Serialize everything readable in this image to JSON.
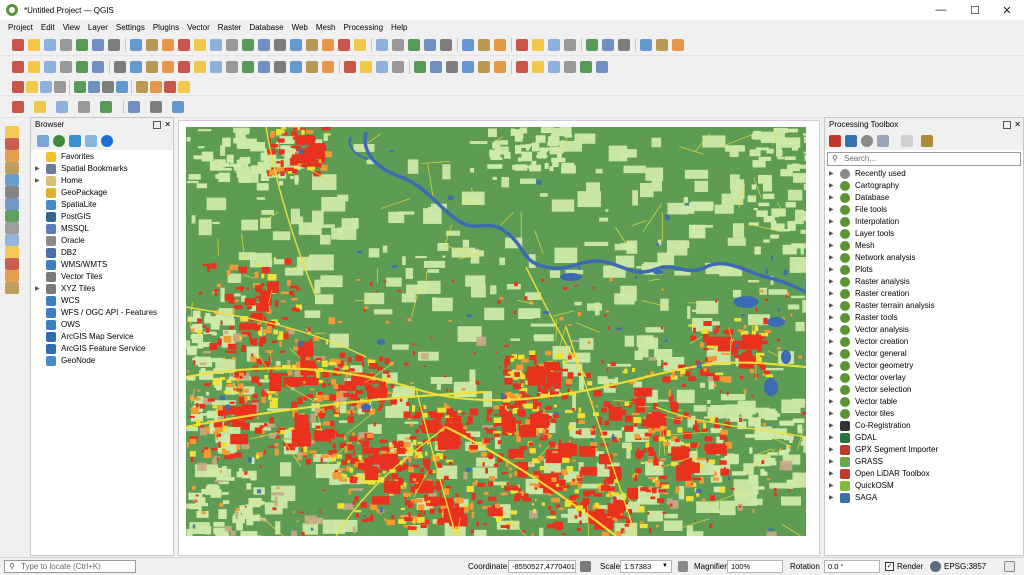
{
  "window": {
    "title": "*Untitled Project — QGIS",
    "minimize": "—",
    "maximize": "☐",
    "close": "✕"
  },
  "menu": [
    "Project",
    "Edit",
    "View",
    "Layer",
    "Settings",
    "Plugins",
    "Vector",
    "Raster",
    "Database",
    "Web",
    "Mesh",
    "Processing",
    "Help"
  ],
  "browser": {
    "title": "Browser",
    "items": [
      {
        "label": "Favorites",
        "icon": "star-icon",
        "color": "#f2c12e",
        "arrow": false
      },
      {
        "label": "Spatial Bookmarks",
        "icon": "bookmark-icon",
        "color": "#6b7d9a",
        "arrow": true
      },
      {
        "label": "Home",
        "icon": "home-folder-icon",
        "color": "#d7c07a",
        "arrow": true
      },
      {
        "label": "GeoPackage",
        "icon": "geopackage-icon",
        "color": "#e0b030",
        "arrow": false
      },
      {
        "label": "SpatiaLite",
        "icon": "spatialite-icon",
        "color": "#4a89c8",
        "arrow": false
      },
      {
        "label": "PostGIS",
        "icon": "postgis-icon",
        "color": "#336791",
        "arrow": false
      },
      {
        "label": "MSSQL",
        "icon": "mssql-icon",
        "color": "#5a7fb8",
        "arrow": false
      },
      {
        "label": "Oracle",
        "icon": "oracle-icon",
        "color": "#8a8a8a",
        "arrow": false
      },
      {
        "label": "DB2",
        "icon": "db2-icon",
        "color": "#4c6fa8",
        "arrow": false
      },
      {
        "label": "WMS/WMTS",
        "icon": "wms-icon",
        "color": "#3d7fc0",
        "arrow": false
      },
      {
        "label": "Vector Tiles",
        "icon": "vector-tiles-icon",
        "color": "#7a7a7a",
        "arrow": false
      },
      {
        "label": "XYZ Tiles",
        "icon": "xyz-tiles-icon",
        "color": "#7a7a7a",
        "arrow": true
      },
      {
        "label": "WCS",
        "icon": "wcs-icon",
        "color": "#3d7fc0",
        "arrow": false
      },
      {
        "label": "WFS / OGC API - Features",
        "icon": "wfs-icon",
        "color": "#3d7fc0",
        "arrow": false
      },
      {
        "label": "OWS",
        "icon": "ows-icon",
        "color": "#3d7fc0",
        "arrow": false
      },
      {
        "label": "ArcGIS Map Service",
        "icon": "arcgis-map-icon",
        "color": "#2f6ea8",
        "arrow": false
      },
      {
        "label": "ArcGIS Feature Service",
        "icon": "arcgis-feature-icon",
        "color": "#2f6ea8",
        "arrow": false
      },
      {
        "label": "GeoNode",
        "icon": "geonode-icon",
        "color": "#4a89c8",
        "arrow": false
      }
    ]
  },
  "toolbox": {
    "title": "Processing Toolbox",
    "search_placeholder": "Search...",
    "items": [
      {
        "label": "Recently used",
        "icon": "clock-icon",
        "color": "#8a8a8a"
      },
      {
        "label": "Cartography",
        "icon": "qgis-algorithm-icon",
        "color": "#589632"
      },
      {
        "label": "Database",
        "icon": "qgis-algorithm-icon",
        "color": "#589632"
      },
      {
        "label": "File tools",
        "icon": "qgis-algorithm-icon",
        "color": "#589632"
      },
      {
        "label": "Interpolation",
        "icon": "qgis-algorithm-icon",
        "color": "#589632"
      },
      {
        "label": "Layer tools",
        "icon": "qgis-algorithm-icon",
        "color": "#589632"
      },
      {
        "label": "Mesh",
        "icon": "qgis-algorithm-icon",
        "color": "#589632"
      },
      {
        "label": "Network analysis",
        "icon": "qgis-algorithm-icon",
        "color": "#589632"
      },
      {
        "label": "Plots",
        "icon": "qgis-algorithm-icon",
        "color": "#589632"
      },
      {
        "label": "Raster analysis",
        "icon": "qgis-algorithm-icon",
        "color": "#589632"
      },
      {
        "label": "Raster creation",
        "icon": "qgis-algorithm-icon",
        "color": "#589632"
      },
      {
        "label": "Raster terrain analysis",
        "icon": "qgis-algorithm-icon",
        "color": "#589632"
      },
      {
        "label": "Raster tools",
        "icon": "qgis-algorithm-icon",
        "color": "#589632"
      },
      {
        "label": "Vector analysis",
        "icon": "qgis-algorithm-icon",
        "color": "#589632"
      },
      {
        "label": "Vector creation",
        "icon": "qgis-algorithm-icon",
        "color": "#589632"
      },
      {
        "label": "Vector general",
        "icon": "qgis-algorithm-icon",
        "color": "#589632"
      },
      {
        "label": "Vector geometry",
        "icon": "qgis-algorithm-icon",
        "color": "#589632"
      },
      {
        "label": "Vector overlay",
        "icon": "qgis-algorithm-icon",
        "color": "#589632"
      },
      {
        "label": "Vector selection",
        "icon": "qgis-algorithm-icon",
        "color": "#589632"
      },
      {
        "label": "Vector table",
        "icon": "qgis-algorithm-icon",
        "color": "#589632"
      },
      {
        "label": "Vector tiles",
        "icon": "qgis-algorithm-icon",
        "color": "#589632"
      },
      {
        "label": "Co-Registration",
        "icon": "coregistration-icon",
        "color": "#333333"
      },
      {
        "label": "GDAL",
        "icon": "gdal-icon",
        "color": "#2d6f3b"
      },
      {
        "label": "GPX Segment Importer",
        "icon": "gpx-icon",
        "color": "#c0392b"
      },
      {
        "label": "GRASS",
        "icon": "grass-icon",
        "color": "#6aa84f"
      },
      {
        "label": "Open LiDAR Toolbox",
        "icon": "lidar-icon",
        "color": "#c0392b"
      },
      {
        "label": "QuickOSM",
        "icon": "quickosm-icon",
        "color": "#7dbb3a"
      },
      {
        "label": "SAGA",
        "icon": "saga-icon",
        "color": "#3d6fa8"
      }
    ]
  },
  "status": {
    "locator_placeholder": "Type to locate (Ctrl+K)",
    "coordinate_label": "Coordinate",
    "coordinate_value": "-8550527,4770401",
    "scale_label": "Scale",
    "scale_value": "1:57383",
    "magnifier_label": "Magnifier",
    "magnifier_value": "100%",
    "rotation_label": "Rotation",
    "rotation_value": "0.0 °",
    "render_label": "Render",
    "crs_label": "EPSG:3857"
  },
  "colors": {
    "forest": "#5e9c56",
    "grass": "#cfe9a8",
    "urban": "#e8321e",
    "urban_mid": "#f59a33",
    "road": "#f2e135",
    "water": "#3d6bb3",
    "barren": "#c9a98a"
  }
}
